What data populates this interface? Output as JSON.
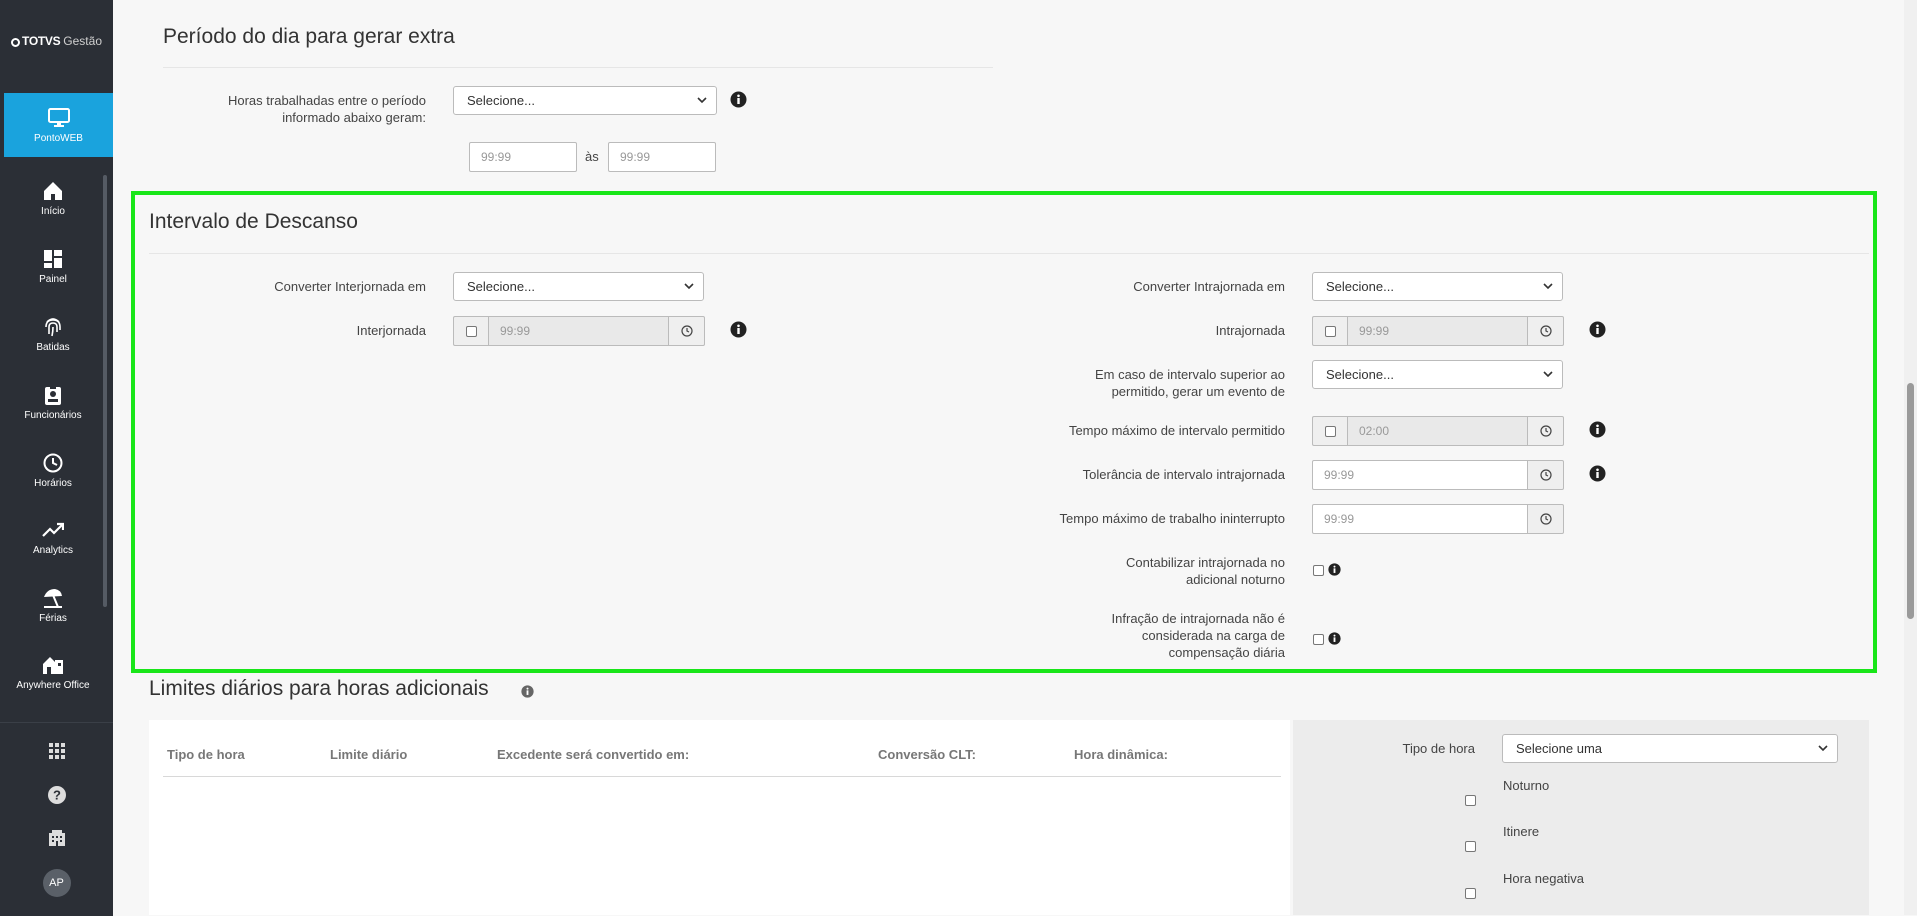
{
  "brand": {
    "name": "TOTVS",
    "product": "Gestão"
  },
  "sidebar": {
    "active": {
      "label": "PontoWEB",
      "icon": "monitor-icon"
    },
    "items": [
      {
        "label": "Início",
        "icon": "home-icon"
      },
      {
        "label": "Painel",
        "icon": "dashboard-icon"
      },
      {
        "label": "Batidas",
        "icon": "fingerprint-icon"
      },
      {
        "label": "Funcionários",
        "icon": "badge-icon"
      },
      {
        "label": "Horários",
        "icon": "clock-icon"
      },
      {
        "label": "Analytics",
        "icon": "trend-icon"
      },
      {
        "label": "Férias",
        "icon": "umbrella-icon"
      },
      {
        "label": "Anywhere Office",
        "icon": "house-office-icon"
      }
    ],
    "footer": {
      "avatar": "AP"
    }
  },
  "section_extra": {
    "title": "Período do dia para gerar extra",
    "label": "Horas trabalhadas entre o período informado abaixo geram:",
    "select": "Selecione...",
    "from_placeholder": "99:99",
    "sep": "às",
    "to_placeholder": "99:99"
  },
  "section_descanso": {
    "title": "Intervalo de Descanso",
    "left": {
      "converter_label": "Converter Interjornada em",
      "converter_value": "Selecione...",
      "inter_label": "Interjornada",
      "inter_value": "99:99"
    },
    "right": {
      "converter_label": "Converter Intrajornada em",
      "converter_value": "Selecione...",
      "intra_label": "Intrajornada",
      "intra_value": "99:99",
      "superior_label": "Em caso de intervalo superior ao permitido, gerar um evento de",
      "superior_value": "Selecione...",
      "max_label": "Tempo máximo de intervalo permitido",
      "max_value": "02:00",
      "tol_label": "Tolerância de intervalo intrajornada",
      "tol_value": "99:99",
      "uninterrupted_label": "Tempo máximo de trabalho ininterrupto",
      "uninterrupted_value": "99:99",
      "noturno_label": "Contabilizar intrajornada no adicional noturno",
      "infracao_label": "Infração de intrajornada não é considerada na carga de compensação diária"
    }
  },
  "section_limites": {
    "title": "Limites diários para horas adicionais",
    "columns": [
      "Tipo de hora",
      "Limite diário",
      "Excedente será convertido em:",
      "Conversão CLT:",
      "Hora dinâmica:"
    ],
    "panel": {
      "tipo_label": "Tipo de hora",
      "tipo_value": "Selecione uma",
      "options": [
        "Noturno",
        "Itinere",
        "Hora negativa"
      ]
    }
  }
}
